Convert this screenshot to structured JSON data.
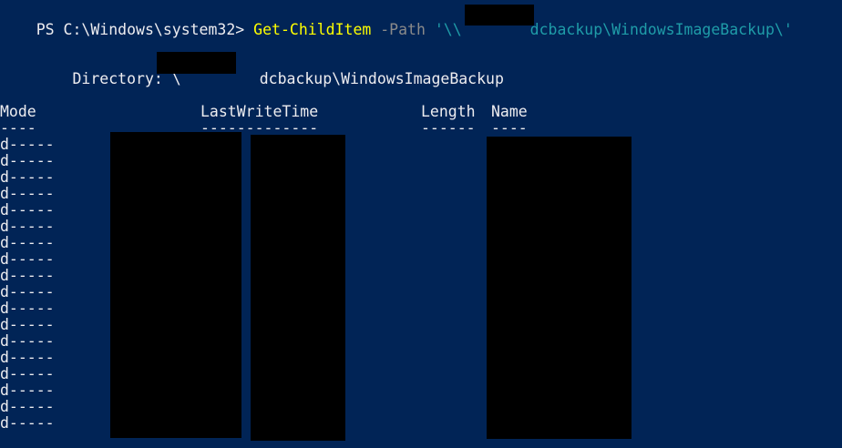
{
  "prompt": {
    "ps_prefix": "PS C:\\Windows\\system32> ",
    "cmdlet": "Get-ChildItem",
    "param": " -Path ",
    "path_open": "'\\\\",
    "path_rest": "dcbackup\\WindowsImageBackup\\'"
  },
  "directory": {
    "label": "    Directory: \\",
    "path_rest": "dcbackup\\WindowsImageBackup"
  },
  "table": {
    "headers": {
      "mode": "Mode",
      "last_write_time": "LastWriteTime",
      "length": "Length",
      "name": "Name"
    },
    "underlines": {
      "mode": "----",
      "last_write_time": "-------------",
      "length": "------",
      "name": "----"
    },
    "rows": [
      {
        "mode": "d-----"
      },
      {
        "mode": "d-----"
      },
      {
        "mode": "d-----"
      },
      {
        "mode": "d-----"
      },
      {
        "mode": "d-----"
      },
      {
        "mode": "d-----"
      },
      {
        "mode": "d-----"
      },
      {
        "mode": "d-----"
      },
      {
        "mode": "d-----"
      },
      {
        "mode": "d-----"
      },
      {
        "mode": "d-----"
      },
      {
        "mode": "d-----"
      },
      {
        "mode": "d-----"
      },
      {
        "mode": "d-----"
      },
      {
        "mode": "d-----"
      },
      {
        "mode": "d-----"
      },
      {
        "mode": "d-----"
      },
      {
        "mode": "d-----"
      }
    ]
  },
  "colors": {
    "background": "#012456",
    "foreground": "#eeedf0",
    "cmdlet": "#ffff00",
    "parameter": "#8a8a8a",
    "string": "#1f9ca8",
    "redaction": "#000000"
  }
}
